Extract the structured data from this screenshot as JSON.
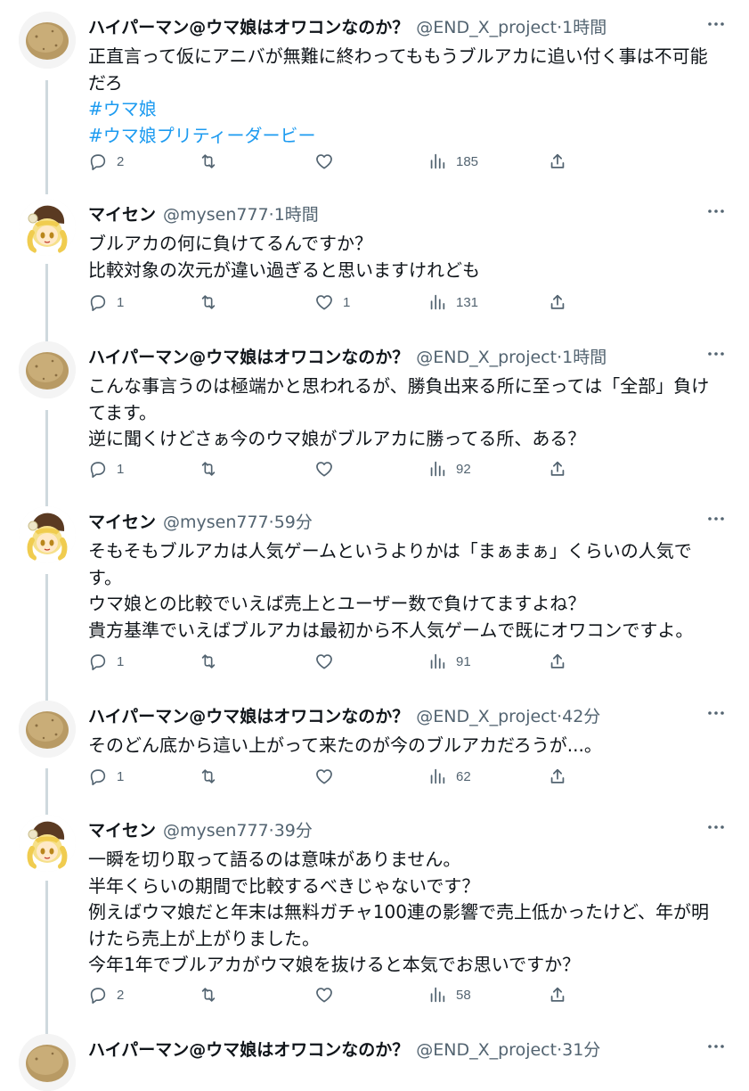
{
  "colors": {
    "text": "#0f1419",
    "secondary": "#536471",
    "hashtag": "#1d9bf0",
    "thread_line": "#cfd9de"
  },
  "tweets": [
    {
      "name": "ハイパーマン@ウマ娘はオワコンなのか？",
      "handle": "@END_X_project",
      "separator": "·",
      "time": "1時間",
      "avatar": "potato-avatar",
      "lines": [
        "正直言って仮にアニバが無難に終わってももうブルアカに追い付く事は不可能",
        "だろ"
      ],
      "hashtags": [
        "#ウマ娘",
        "#ウマ娘プリティーダービー"
      ],
      "replies": "2",
      "retweets": "",
      "likes": "",
      "views": "185"
    },
    {
      "name": "マイセン",
      "handle": "@mysen777",
      "separator": "·",
      "time": "1時間",
      "avatar": "blonde-girl-avatar",
      "lines": [
        "ブルアカの何に負けてるんですか？",
        "比較対象の次元が違い過ぎると思いますけれども"
      ],
      "hashtags": [],
      "replies": "1",
      "retweets": "",
      "likes": "1",
      "views": "131"
    },
    {
      "name": "ハイパーマン@ウマ娘はオワコンなのか？",
      "handle": "@END_X_project",
      "separator": "·",
      "time": "1時間",
      "avatar": "potato-avatar",
      "lines": [
        "こんな事言うのは極端かと思われるが、勝負出来る所に至っては「全部」負け",
        "てます。",
        "逆に聞くけどさぁ今のウマ娘がブルアカに勝ってる所、ある？"
      ],
      "hashtags": [],
      "replies": "1",
      "retweets": "",
      "likes": "",
      "views": "92"
    },
    {
      "name": "マイセン",
      "handle": "@mysen777",
      "separator": "·",
      "time": "59分",
      "avatar": "blonde-girl-avatar",
      "lines": [
        "そもそもブルアカは人気ゲームというよりかは「まぁまぁ」くらいの人気で",
        "す。",
        "ウマ娘との比較でいえば売上とユーザー数で負けてますよね？",
        "貴方基準でいえばブルアカは最初から不人気ゲームで既にオワコンですよ。"
      ],
      "hashtags": [],
      "replies": "1",
      "retweets": "",
      "likes": "",
      "views": "91"
    },
    {
      "name": "ハイパーマン@ウマ娘はオワコンなのか？",
      "handle": "@END_X_project",
      "separator": "·",
      "time": "42分",
      "avatar": "potato-avatar",
      "lines": [
        "そのどん底から這い上がって来たのが今のブルアカだろうが...。"
      ],
      "hashtags": [],
      "replies": "1",
      "retweets": "",
      "likes": "",
      "views": "62"
    },
    {
      "name": "マイセン",
      "handle": "@mysen777",
      "separator": "·",
      "time": "39分",
      "avatar": "blonde-girl-avatar",
      "lines": [
        "一瞬を切り取って語るのは意味がありません。",
        "半年くらいの期間で比較するべきじゃないです？",
        "例えばウマ娘だと年末は無料ガチャ100連の影響で売上低かったけど、年が明",
        "けたら売上が上がりました。",
        "今年1年でブルアカがウマ娘を抜けると本気でお思いですか？"
      ],
      "hashtags": [],
      "replies": "2",
      "retweets": "",
      "likes": "",
      "views": "58"
    },
    {
      "name": "ハイパーマン@ウマ娘はオワコンなのか？",
      "handle": "@END_X_project",
      "separator": "·",
      "time": "31分",
      "avatar": "potato-avatar",
      "lines": [],
      "hashtags": [],
      "replies": "",
      "retweets": "",
      "likes": "",
      "views": ""
    }
  ]
}
